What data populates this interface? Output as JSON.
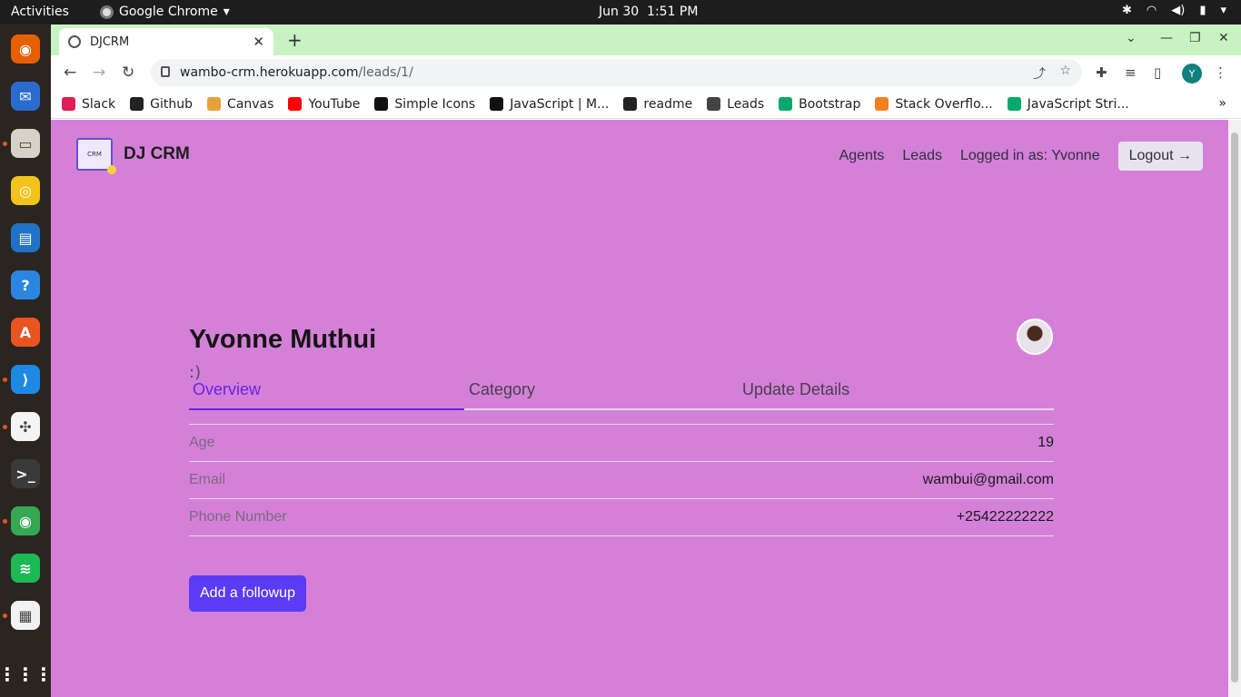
{
  "topbar": {
    "activities": "Activities",
    "app_name": "Google Chrome",
    "date": "Jun 30",
    "time": "1:51 PM"
  },
  "dock": {
    "apps": [
      {
        "name": "firefox-icon",
        "color": "#e66000",
        "running": false
      },
      {
        "name": "thunderbird-icon",
        "color": "#2a6bd0",
        "running": false
      },
      {
        "name": "files-icon",
        "color": "#d7d2c8",
        "running": true
      },
      {
        "name": "rhythmbox-icon",
        "color": "#f0c419",
        "running": false
      },
      {
        "name": "libreoffice-writer-icon",
        "color": "#1f73c7",
        "running": false
      },
      {
        "name": "help-icon",
        "color": "#2a86e0",
        "running": false
      },
      {
        "name": "software-icon",
        "color": "#e95420",
        "running": false
      },
      {
        "name": "vscode-icon",
        "color": "#1e88e5",
        "running": true
      },
      {
        "name": "slack-icon",
        "color": "#f4f4f4",
        "running": true
      },
      {
        "name": "terminal-icon",
        "color": "#3a3a3a",
        "running": false
      },
      {
        "name": "chrome-icon",
        "color": "#34a853",
        "running": true
      },
      {
        "name": "spotify-icon",
        "color": "#1db954",
        "running": false
      },
      {
        "name": "text-editor-icon",
        "color": "#f2f2f2",
        "running": true
      }
    ]
  },
  "browser": {
    "tab_title": "DJCRM",
    "url_host": "wambo-crm.herokuapp.com",
    "url_path": "/leads/1/",
    "profile_initial": "Y",
    "bookmarks": [
      {
        "label": "Slack",
        "icon": "slack-icon",
        "color": "#e01e5a"
      },
      {
        "label": "Github",
        "icon": "github-icon",
        "color": "#222222"
      },
      {
        "label": "Canvas",
        "icon": "canvas-icon",
        "color": "#e4a13c"
      },
      {
        "label": "YouTube",
        "icon": "youtube-icon",
        "color": "#ff0000"
      },
      {
        "label": "Simple Icons",
        "icon": "simple-icons-icon",
        "color": "#111111"
      },
      {
        "label": "JavaScript | M...",
        "icon": "mdn-icon",
        "color": "#111111"
      },
      {
        "label": "readme",
        "icon": "github-icon",
        "color": "#222222"
      },
      {
        "label": "Leads",
        "icon": "globe-icon",
        "color": "#444444"
      },
      {
        "label": "Bootstrap",
        "icon": "w3schools-icon",
        "color": "#04aa6d"
      },
      {
        "label": "Stack Overflo...",
        "icon": "stackoverflow-icon",
        "color": "#f48024"
      },
      {
        "label": "JavaScript Stri...",
        "icon": "w3schools-icon",
        "color": "#04aa6d"
      }
    ]
  },
  "app": {
    "brand": "DJ CRM",
    "logo_text": "CRM",
    "nav": {
      "agents": "Agents",
      "leads": "Leads",
      "logged_in": "Logged in as: Yvonne",
      "logout": "Logout →"
    },
    "lead": {
      "name": "Yvonne Muthui",
      "subtitle": ":)",
      "tabs": [
        "Overview",
        "Category",
        "Update Details"
      ],
      "fields": [
        {
          "label": "Age",
          "value": "19"
        },
        {
          "label": "Email",
          "value": "wambui@gmail.com"
        },
        {
          "label": "Phone Number",
          "value": "+25422222222"
        }
      ],
      "followup_button": "Add a followup"
    },
    "colors": {
      "page_bg": "#d480d8",
      "accent": "#6b21e6",
      "button": "#5b3bf5"
    }
  }
}
